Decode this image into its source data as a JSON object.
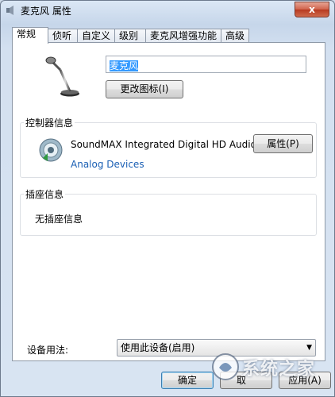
{
  "window": {
    "title": "麦克风 属性",
    "close_label": "x"
  },
  "tabs": [
    {
      "label": "常规",
      "active": true
    },
    {
      "label": "侦听",
      "active": false
    },
    {
      "label": "自定义",
      "active": false
    },
    {
      "label": "级别",
      "active": false
    },
    {
      "label": "麦克风增强功能",
      "active": false
    },
    {
      "label": "高级",
      "active": false
    }
  ],
  "general": {
    "device_name_value": "麦克风",
    "change_icon_button": "更改图标(I)"
  },
  "controller": {
    "group_label": "控制器信息",
    "device": "SoundMAX Integrated Digital HD Audio",
    "properties_button": "属性(P)",
    "vendor": "Analog Devices"
  },
  "jack": {
    "group_label": "插座信息",
    "info": "无插座信息"
  },
  "usage": {
    "label": "设备用法:",
    "selected": "使用此设备(启用)"
  },
  "footer": {
    "ok_label": "确定",
    "cancel_partial": "取",
    "apply_partial": "应用(A)"
  },
  "watermark": {
    "text": "系统之家"
  },
  "colors": {
    "selection": "#3399ff",
    "link": "#1a5fb4",
    "close": "#c8462c"
  }
}
